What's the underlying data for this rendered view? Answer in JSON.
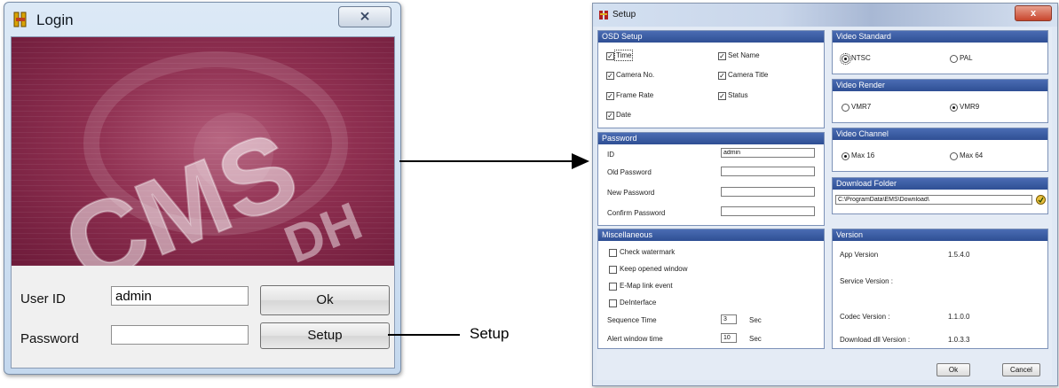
{
  "login": {
    "title": "Login",
    "close": "⨯",
    "user_id_label": "User ID",
    "user_id_value": "admin",
    "password_label": "Password",
    "password_value": "",
    "ok_label": "Ok",
    "setup_label": "Setup"
  },
  "annotation": {
    "setup_callout": "Setup"
  },
  "setup": {
    "title": "Setup",
    "close": "x",
    "osd": {
      "header": "OSD Setup",
      "items": [
        {
          "label": "Time",
          "checked": true
        },
        {
          "label": "Set Name",
          "checked": true
        },
        {
          "label": "Camera No.",
          "checked": true
        },
        {
          "label": "Camera Title",
          "checked": true
        },
        {
          "label": "Frame Rate",
          "checked": true
        },
        {
          "label": "Status",
          "checked": true
        },
        {
          "label": "Date",
          "checked": true
        }
      ]
    },
    "video_standard": {
      "header": "Video Standard",
      "opt1": "NTSC",
      "opt2": "PAL",
      "selected": "NTSC"
    },
    "video_render": {
      "header": "Video Render",
      "opt1": "VMR7",
      "opt2": "VMR9",
      "selected": "VMR9"
    },
    "password": {
      "header": "Password",
      "id_label": "ID",
      "id_value": "admin",
      "old_label": "Old Password",
      "new_label": "New Password",
      "confirm_label": "Confirm Password"
    },
    "video_channel": {
      "header": "Video Channel",
      "opt1": "Max 16",
      "opt2": "Max 64",
      "selected": "Max 16"
    },
    "download_folder": {
      "header": "Download Folder",
      "path": "C:\\ProgramData\\EMS\\Download\\"
    },
    "misc": {
      "header": "Miscellaneous",
      "check_watermark": "Check watermark",
      "keep_opened": "Keep opened window",
      "emap_link": "E-Map link event",
      "deinterlace": "DeInterface",
      "sequence_label": "Sequence Time",
      "sequence_value": "3",
      "alert_label": "Alert window time",
      "alert_value": "10",
      "unit": "Sec"
    },
    "version": {
      "header": "Version",
      "app_label": "App Version",
      "app_value": "1.5.4.0",
      "service_label": "Service Version :",
      "codec_label": "Codec Version :",
      "codec_value": "1.1.0.0",
      "dll_label": "Download dll Version :",
      "dll_value": "1.0.3.3"
    },
    "ok_label": "Ok",
    "cancel_label": "Cancel"
  }
}
